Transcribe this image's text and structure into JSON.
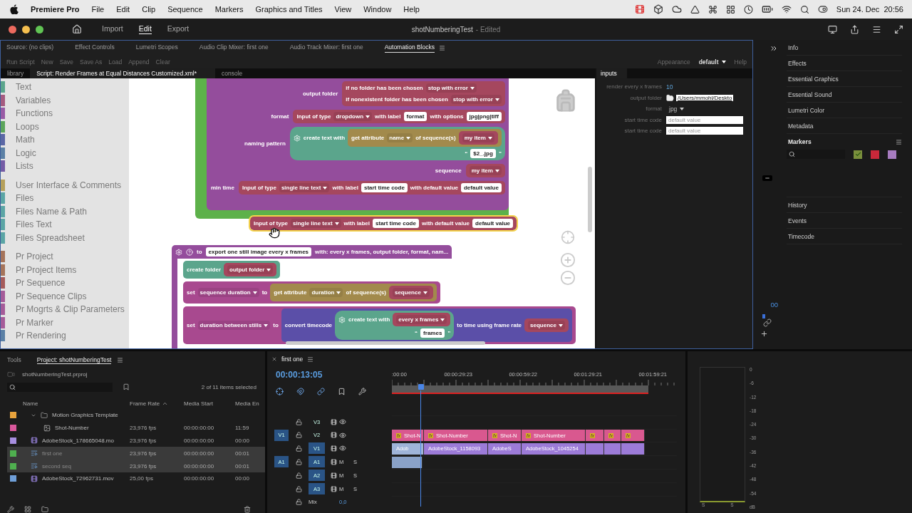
{
  "menu_bar": {
    "app": "Premiere Pro",
    "menus": [
      "File",
      "Edit",
      "Clip",
      "Sequence",
      "Markers",
      "Graphics and Titles",
      "View",
      "Window",
      "Help"
    ],
    "clock": "Sun 24. Dec  20:56"
  },
  "title_bar": {
    "workspaces": [
      {
        "label": "Import",
        "selected": false
      },
      {
        "label": "Edit",
        "selected": true
      },
      {
        "label": "Export",
        "selected": false
      }
    ],
    "title": "shotNumberingTest",
    "status": "- Edited"
  },
  "panel_tabs": [
    {
      "label": "Source: (no clips)",
      "selected": false
    },
    {
      "label": "Effect Controls",
      "selected": false
    },
    {
      "label": "Lumetri Scopes",
      "selected": false
    },
    {
      "label": "Audio Clip Mixer: first one",
      "selected": false
    },
    {
      "label": "Audio Track Mixer: first one",
      "selected": false
    },
    {
      "label": "Automation Blocks",
      "selected": true
    }
  ],
  "toolbar": {
    "actions": [
      "Run Script",
      "New",
      "Save",
      "Save As",
      "Load",
      "Append",
      "Clear"
    ],
    "appearance_label": "Appearance",
    "appearance": "default",
    "help": "Help"
  },
  "editor_tabs": [
    {
      "label": "library",
      "selected": false
    },
    {
      "label": "Script: Render Frames at Equal Distances Customized.xml*",
      "selected": true
    },
    {
      "label": "console",
      "selected": false
    }
  ],
  "library": [
    {
      "items": [
        {
          "label": "Text",
          "color": "#5ba58c"
        },
        {
          "label": "Variables",
          "color": "#a55b80"
        },
        {
          "label": "Functions",
          "color": "#995ba5"
        },
        {
          "label": "Loops",
          "color": "#5ba55b"
        },
        {
          "label": "Math",
          "color": "#5b67a5"
        },
        {
          "label": "Logic",
          "color": "#5b80a5"
        },
        {
          "label": "Lists",
          "color": "#745ba5"
        }
      ]
    },
    {
      "items": [
        {
          "label": "User Interface & Comments",
          "color": "#b5a05b"
        },
        {
          "label": "Files",
          "color": "#5ba5a5"
        },
        {
          "label": "Files Name & Path",
          "color": "#5ba5a5"
        },
        {
          "label": "Files Text",
          "color": "#5ba5a5"
        },
        {
          "label": "Files Spreadsheet",
          "color": "#5ba5a5"
        }
      ]
    },
    {
      "items": [
        {
          "label": "Pr Project",
          "color": "#a5745b"
        },
        {
          "label": "Pr Project Items",
          "color": "#a5745b"
        },
        {
          "label": "Pr Sequence",
          "color": "#a55b5b"
        },
        {
          "label": "Pr Sequence Clips",
          "color": "#a55b99"
        },
        {
          "label": "Pr Mogrts & Clip Parameters",
          "color": "#a55b99"
        },
        {
          "label": "Pr Marker",
          "color": "#a55b99"
        },
        {
          "label": "Pr Rendering",
          "color": "#5b80a5"
        }
      ]
    }
  ],
  "workspace": {
    "blocks": [
      {
        "kind": "c-block",
        "color": "#5db14a",
        "inner": {
          "color": "#944d9c",
          "rows": [
            {
              "label": "output folder",
              "content": [
                {
                  "kind": "block",
                  "color": "#a5475e",
                  "rows": [
                    [
                      {
                        "kind": "label",
                        "text": "if no folder has been chosen"
                      },
                      {
                        "kind": "dropdown",
                        "text": "stop with error"
                      }
                    ],
                    [
                      {
                        "kind": "label",
                        "text": "if nonexistent folder has been chosen"
                      },
                      {
                        "kind": "dropdown",
                        "text": "stop with error"
                      }
                    ]
                  ]
                }
              ]
            },
            {
              "label": "format",
              "content": [
                {
                  "kind": "block",
                  "color": "#a5475e",
                  "rows": [
                    [
                      {
                        "kind": "label",
                        "text": "Input of type"
                      },
                      {
                        "kind": "dropdown",
                        "text": "dropdown"
                      },
                      {
                        "kind": "label",
                        "text": "with label"
                      },
                      {
                        "kind": "field",
                        "text": "format"
                      },
                      {
                        "kind": "label",
                        "text": "with options"
                      },
                      {
                        "kind": "field",
                        "text": "jpg|png|tiff"
                      }
                    ]
                  ]
                }
              ]
            },
            {
              "label": "naming pattern",
              "content": [
                {
                  "kind": "join",
                  "color": "#5ba58c",
                  "parts": [
                    {
                      "kind": "gear"
                    },
                    {
                      "kind": "label",
                      "text": "create text with"
                    },
                    {
                      "kind": "block",
                      "color": "#a28a4c",
                      "rows": [
                        [
                          {
                            "kind": "label",
                            "text": "get attribute"
                          },
                          {
                            "kind": "dropdown",
                            "text": "name"
                          },
                          {
                            "kind": "label",
                            "text": "of sequence(s)"
                          },
                          {
                            "kind": "block",
                            "color": "#a5475e",
                            "rows": [
                              [
                                {
                                  "kind": "dropdown",
                                  "text": "my item"
                                }
                              ]
                            ]
                          }
                        ]
                      ]
                    }
                  ],
                  "literal": {
                    "open": "“",
                    "text": "$2_.jpg",
                    "close": "”"
                  }
                }
              ]
            },
            {
              "label": "sequence",
              "content": [
                {
                  "kind": "block",
                  "color": "#a5475e",
                  "rows": [
                    [
                      {
                        "kind": "dropdown",
                        "text": "my item"
                      }
                    ]
                  ]
                }
              ]
            },
            {
              "label": "min time",
              "content": [
                {
                  "kind": "block",
                  "color": "#a5475e",
                  "rows": [
                    [
                      {
                        "kind": "label",
                        "text": "Input of type"
                      },
                      {
                        "kind": "dropdown",
                        "text": "single line text"
                      },
                      {
                        "kind": "label",
                        "text": "with label"
                      },
                      {
                        "kind": "field",
                        "text": "start time code"
                      },
                      {
                        "kind": "label",
                        "text": "with default value"
                      },
                      {
                        "kind": "field",
                        "text": "default value"
                      }
                    ]
                  ]
                }
              ]
            }
          ]
        }
      },
      {
        "kind": "loose",
        "block": {
          "kind": "block",
          "color": "#a5475e",
          "highlighted": true,
          "rows": [
            [
              {
                "kind": "label",
                "text": "Input of type"
              },
              {
                "kind": "dropdown",
                "text": "single line text"
              },
              {
                "kind": "label",
                "text": "with label"
              },
              {
                "kind": "field",
                "text": "start time code"
              },
              {
                "kind": "label",
                "text": "with default value"
              },
              {
                "kind": "field",
                "text": "default value"
              }
            ]
          ]
        }
      },
      {
        "kind": "procedure",
        "color": "#944d9c",
        "header": [
          {
            "kind": "gear"
          },
          {
            "kind": "help"
          },
          {
            "kind": "label",
            "text": "to"
          },
          {
            "kind": "field",
            "text": "export one still image every x frames"
          },
          {
            "kind": "label",
            "text": "with: every x frames, output folder, format, nam..."
          }
        ],
        "statements": [
          {
            "kind": "block",
            "color": "#5ba58c",
            "rows": [
              [
                {
                  "kind": "label",
                  "text": "create folder"
                },
                {
                  "kind": "block",
                  "color": "#a5475e",
                  "rows": [
                    [
                      {
                        "kind": "dropdown",
                        "text": "output folder"
                      }
                    ]
                  ]
                }
              ]
            ]
          },
          {
            "kind": "block",
            "color": "#a8498f",
            "rows": [
              [
                {
                  "kind": "label",
                  "text": "set"
                },
                {
                  "kind": "dropdown",
                  "text": "sequence duration"
                },
                {
                  "kind": "label",
                  "text": "to"
                },
                {
                  "kind": "block",
                  "color": "#a28a4c",
                  "rows": [
                    [
                      {
                        "kind": "label",
                        "text": "get attribute"
                      },
                      {
                        "kind": "dropdown",
                        "text": "duration"
                      },
                      {
                        "kind": "label",
                        "text": "of sequence(s)"
                      },
                      {
                        "kind": "block",
                        "color": "#a5475e",
                        "rows": [
                          [
                            {
                              "kind": "dropdown",
                              "text": "sequence"
                            }
                          ]
                        ]
                      }
                    ]
                  ]
                }
              ]
            ]
          },
          {
            "kind": "block",
            "color": "#a8498f",
            "rows": [
              [
                {
                  "kind": "label",
                  "text": "set"
                },
                {
                  "kind": "dropdown",
                  "text": "duration between stills"
                },
                {
                  "kind": "label",
                  "text": "to"
                },
                {
                  "kind": "block",
                  "color": "#5b4fa8",
                  "rows": [
                    [
                      {
                        "kind": "label",
                        "text": "convert timecode"
                      },
                      {
                        "kind": "join",
                        "color": "#5ba58c",
                        "parts": [
                          {
                            "kind": "gear"
                          },
                          {
                            "kind": "label",
                            "text": "create text with"
                          },
                          {
                            "kind": "block",
                            "color": "#a5475e",
                            "rows": [
                              [
                                {
                                  "kind": "dropdown",
                                  "text": "every x frames"
                                }
                              ]
                            ]
                          }
                        ],
                        "literal": {
                          "open": "“",
                          "text": "frames",
                          "close": "”"
                        }
                      },
                      {
                        "kind": "label",
                        "text": "to time using frame rate"
                      },
                      {
                        "kind": "block",
                        "color": "#a5475e",
                        "rows": [
                          [
                            {
                              "kind": "dropdown",
                              "text": "sequence"
                            }
                          ]
                        ]
                      }
                    ]
                  ]
                }
              ]
            ]
          }
        ]
      }
    ]
  },
  "inputs": {
    "title": "inputs",
    "rows": [
      {
        "kind": "text",
        "label": "render every x frames",
        "value": "10"
      },
      {
        "kind": "folder",
        "label": "output folder",
        "value": "/Users/mmohl/Deskto"
      },
      {
        "kind": "dropdown",
        "label": "format",
        "value": "jpg"
      },
      {
        "kind": "textfield",
        "label": "start time code",
        "placeholder": "default value"
      },
      {
        "kind": "textfield",
        "label": "start time code",
        "placeholder": "default value"
      }
    ]
  },
  "strip": {
    "value": "00"
  },
  "side_panels": {
    "upper": [
      "Info",
      "Effects",
      "Essential Graphics",
      "Essential Sound",
      "Lumetri Color",
      "Metadata"
    ],
    "markers": {
      "title": "Markers",
      "swatches": [
        {
          "color": "#7a8f3c",
          "checked": true
        },
        {
          "color": "#c8283a",
          "checked": false
        },
        {
          "color": "#a77cc0",
          "checked": false
        }
      ]
    },
    "lower": [
      "History",
      "Events",
      "Timecode"
    ]
  },
  "project": {
    "tabs": [
      {
        "label": "Tools",
        "selected": false
      },
      {
        "label": "Project: shotNumberingTest",
        "selected": true
      }
    ],
    "file": "shotNumberingTest.prproj",
    "selection": "2 of 11 items selected",
    "columns": [
      {
        "label": "Name",
        "sorted": false
      },
      {
        "label": "Frame Rate",
        "sorted": true
      },
      {
        "label": "Media Start",
        "sorted": false
      },
      {
        "label": "Media En",
        "sorted": false
      }
    ],
    "rows": [
      {
        "kind": "bin",
        "name": "Motion Graphics Template",
        "color": "#e8a33c",
        "selected": false,
        "expanded": true,
        "children": [
          {
            "kind": "graphic",
            "name": "Shot-Number",
            "color": "#d9589c",
            "selected": false,
            "frame_rate": "23,976 fps",
            "media_start": "00:00:00:00",
            "media_end": "11:59"
          }
        ]
      },
      {
        "kind": "video",
        "name": "AdobeStock_178665048.mo",
        "color": "#a78ee0",
        "selected": false,
        "frame_rate": "23,976 fps",
        "media_start": "00:00:00:00",
        "media_end": "00:00"
      },
      {
        "kind": "sequence",
        "name": "first one",
        "color": "#4fb04f",
        "selected": true,
        "frame_rate": "23,976 fps",
        "media_start": "00:00:00:00",
        "media_end": "00:01"
      },
      {
        "kind": "sequence",
        "name": "second seq",
        "color": "#4fb04f",
        "selected": true,
        "frame_rate": "23,976 fps",
        "media_start": "00:00:00:00",
        "media_end": "00:01"
      },
      {
        "kind": "video",
        "name": "AdobeStock_72962731.mov",
        "color": "#6f9fd8",
        "selected": false,
        "frame_rate": "25,00 fps",
        "media_start": "00:00:00:00",
        "media_end": "00:00"
      }
    ]
  },
  "timeline": {
    "tab": "first one",
    "timecode": "00:00:13:05",
    "ruler": [
      ":00:00",
      "00:00:29:23",
      "00:00:59:22",
      "00:01:29:21",
      "00:01:59:21"
    ],
    "tracks": [
      {
        "kind": "video",
        "name": "V3",
        "targeted": false
      },
      {
        "kind": "video",
        "name": "V2",
        "source": "V1",
        "targeted": false,
        "clips": [
          {
            "kind": "graphic",
            "label": "Shot-N",
            "badge": "fx",
            "selected": false
          },
          {
            "kind": "graphic",
            "label": "Shot-Number",
            "badge": "fx",
            "selected": false
          },
          {
            "kind": "graphic",
            "label": "Shot-N",
            "badge": "fx",
            "selected": false
          },
          {
            "kind": "graphic",
            "label": "Shot-Number",
            "badge": "fx",
            "selected": false
          },
          {
            "kind": "graphic",
            "badge": "fx",
            "selected": false
          },
          {
            "kind": "graphic",
            "badge": "fx",
            "selected": false
          },
          {
            "kind": "graphic",
            "badge": "fx",
            "selected": false
          }
        ]
      },
      {
        "kind": "video",
        "name": "V1",
        "targeted": true,
        "clips": [
          {
            "kind": "video",
            "label": "Adob",
            "selected": true
          },
          {
            "kind": "video",
            "label": "AdobeStock_1158093",
            "selected": false
          },
          {
            "kind": "video",
            "label": "AdobeS",
            "selected": false
          },
          {
            "kind": "video",
            "label": "AdobeStock_1045254",
            "selected": false
          },
          {
            "kind": "video",
            "selected": false
          },
          {
            "kind": "video",
            "selected": false
          },
          {
            "kind": "video",
            "selected": false
          }
        ]
      },
      {
        "kind": "audio",
        "name": "A1",
        "source": "A1",
        "targeted": true,
        "mute": "M",
        "solo": "S",
        "clips": [
          {
            "kind": "audio",
            "selected": true
          }
        ]
      },
      {
        "kind": "audio",
        "name": "A2",
        "targeted": true,
        "mute": "M",
        "solo": "S"
      },
      {
        "kind": "audio",
        "name": "A3",
        "targeted": true,
        "mute": "M",
        "solo": "S"
      }
    ],
    "mix": {
      "label": "Mix",
      "value": "0,0"
    }
  },
  "meter": {
    "scale": [
      "0",
      "-6",
      "-12",
      "-18",
      "-24",
      "-30",
      "-36",
      "-42",
      "-48",
      "-54",
      "dB"
    ],
    "channels": [
      "S",
      "S"
    ]
  }
}
